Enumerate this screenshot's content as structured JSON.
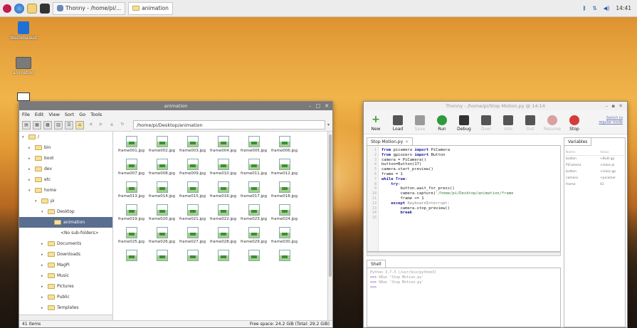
{
  "taskbar": {
    "tasks": [
      {
        "label": "Thonny - /home/pi/..."
      },
      {
        "label": "animation"
      }
    ],
    "clock": "14:41"
  },
  "desktop": {
    "icons": [
      {
        "label": "Wastebasket"
      },
      {
        "label": "animation"
      }
    ]
  },
  "file_manager": {
    "title": "animation",
    "menu": [
      "File",
      "Edit",
      "View",
      "Sort",
      "Go",
      "Tools"
    ],
    "path": "/home/pi/Desktop/animation",
    "tree": [
      {
        "label": "/",
        "depth": 0,
        "arrow": "▾"
      },
      {
        "label": "bin",
        "depth": 1,
        "arrow": "▸"
      },
      {
        "label": "boot",
        "depth": 1,
        "arrow": "▸"
      },
      {
        "label": "dev",
        "depth": 1,
        "arrow": "▸"
      },
      {
        "label": "etc",
        "depth": 1,
        "arrow": "▸"
      },
      {
        "label": "home",
        "depth": 1,
        "arrow": "▾"
      },
      {
        "label": "pi",
        "depth": 2,
        "arrow": "▾"
      },
      {
        "label": "Desktop",
        "depth": 3,
        "arrow": "▾"
      },
      {
        "label": "animation",
        "depth": 4,
        "arrow": "▾",
        "selected": true
      },
      {
        "label": "<No sub-folders>",
        "depth": 5,
        "arrow": ""
      },
      {
        "label": "Documents",
        "depth": 3,
        "arrow": "▸"
      },
      {
        "label": "Downloads",
        "depth": 3,
        "arrow": "▸"
      },
      {
        "label": "MagPi",
        "depth": 3,
        "arrow": "▸"
      },
      {
        "label": "Music",
        "depth": 3,
        "arrow": "▸"
      },
      {
        "label": "Pictures",
        "depth": 3,
        "arrow": "▸"
      },
      {
        "label": "Public",
        "depth": 3,
        "arrow": "▸"
      },
      {
        "label": "Templates",
        "depth": 3,
        "arrow": "▸"
      }
    ],
    "files": [
      "frame001.jpg",
      "frame002.jpg",
      "frame003.jpg",
      "frame004.jpg",
      "frame005.jpg",
      "frame006.jpg",
      "frame007.jpg",
      "frame008.jpg",
      "frame009.jpg",
      "frame010.jpg",
      "frame011.jpg",
      "frame012.jpg",
      "frame013.jpg",
      "frame014.jpg",
      "frame015.jpg",
      "frame016.jpg",
      "frame017.jpg",
      "frame018.jpg",
      "frame019.jpg",
      "frame020.jpg",
      "frame021.jpg",
      "frame022.jpg",
      "frame023.jpg",
      "frame024.jpg",
      "frame025.jpg",
      "frame026.jpg",
      "frame027.jpg",
      "frame028.jpg",
      "frame029.jpg",
      "frame030.jpg",
      "",
      "",
      "",
      "",
      "",
      ""
    ],
    "status_left": "41 items",
    "status_right": "Free space: 24.2 GiB (Total: 29.2 GiB)"
  },
  "thonny": {
    "title": "Thonny - /home/pi/Stop Motion.py @ 14:14",
    "switch_mode": [
      "Switch to",
      "regular mode"
    ],
    "toolbar": [
      {
        "label": "New",
        "icon": "new-icon",
        "color": "#3a9a3a",
        "enabled": true
      },
      {
        "label": "Load",
        "icon": "load-icon",
        "color": "#555555",
        "enabled": true
      },
      {
        "label": "Save",
        "icon": "save-icon",
        "color": "#9a9a9a",
        "enabled": false
      },
      {
        "label": "Run",
        "icon": "run-icon",
        "color": "#2e9a3a",
        "enabled": true
      },
      {
        "label": "Debug",
        "icon": "debug-icon",
        "color": "#333333",
        "enabled": true
      },
      {
        "label": "Over",
        "icon": "step-over-icon",
        "color": "#555555",
        "enabled": false
      },
      {
        "label": "Into",
        "icon": "step-into-icon",
        "color": "#555555",
        "enabled": false
      },
      {
        "label": "Out",
        "icon": "step-out-icon",
        "color": "#555555",
        "enabled": false
      },
      {
        "label": "Resume",
        "icon": "resume-icon",
        "color": "#d8a0a0",
        "enabled": false
      },
      {
        "label": "Stop",
        "icon": "stop-icon",
        "color": "#d83a3a",
        "enabled": true
      }
    ],
    "editor_tab": "Stop Motion.py",
    "line_numbers": [
      "1",
      "2",
      "3",
      "4",
      "5",
      "6",
      "7",
      "8",
      "9",
      "10",
      "11",
      "12",
      "13",
      "14",
      "15"
    ],
    "code_lines": [
      [
        {
          "t": "from ",
          "c": "kw"
        },
        {
          "t": "picamera ",
          "c": ""
        },
        {
          "t": "import ",
          "c": "kw"
        },
        {
          "t": "PiCamera",
          "c": ""
        }
      ],
      [
        {
          "t": "from ",
          "c": "kw"
        },
        {
          "t": "gpiozero ",
          "c": ""
        },
        {
          "t": "import ",
          "c": "kw"
        },
        {
          "t": "Button",
          "c": ""
        }
      ],
      [
        {
          "t": "camera = PiCamera()",
          "c": ""
        }
      ],
      [
        {
          "t": "button=Button(17)",
          "c": ""
        }
      ],
      [
        {
          "t": "camera.start_preview()",
          "c": ""
        }
      ],
      [
        {
          "t": "frame = 1",
          "c": ""
        }
      ],
      [
        {
          "t": "while True",
          "c": "kw"
        },
        {
          "t": ":",
          "c": ""
        }
      ],
      [
        {
          "t": "    try",
          "c": "kw"
        },
        {
          "t": ":",
          "c": ""
        }
      ],
      [
        {
          "t": "        button.wait_for_press()",
          "c": ""
        }
      ],
      [
        {
          "t": "        camera.capture(",
          "c": ""
        },
        {
          "t": "'/home/pi/Desktop/animation/frame",
          "c": "str"
        }
      ],
      [
        {
          "t": "        frame += 1",
          "c": ""
        }
      ],
      [
        {
          "t": "    except ",
          "c": "kw"
        },
        {
          "t": "KeyboardInterrupt:",
          "c": "cm"
        }
      ],
      [
        {
          "t": "        camera.stop_preview()",
          "c": ""
        }
      ],
      [
        {
          "t": "        break",
          "c": "kw"
        }
      ],
      [
        {
          "t": "",
          "c": ""
        }
      ]
    ],
    "shell_tab": "Shell",
    "shell_lines": [
      {
        "prompt": "",
        "text": "Python 3.7.3 (/usr/bin/python3)"
      },
      {
        "prompt": ">>>",
        "text": "%Run 'Stop Motion.py'"
      },
      {
        "prompt": ">>>",
        "text": "%Run 'Stop Motion.py'"
      },
      {
        "prompt": ">>>",
        "text": ""
      }
    ],
    "variables_tab": "Variables",
    "variables_header": {
      "name": "Name",
      "value": "Value"
    },
    "variables": [
      {
        "name": "button",
        "value": "<Butt gp"
      },
      {
        "name": "PiCamera",
        "value": "<class pi"
      },
      {
        "name": "button",
        "value": "<class gp"
      },
      {
        "name": "camera",
        "value": "<picamer"
      },
      {
        "name": "frame",
        "value": "41"
      }
    ]
  },
  "colors": {
    "selection": "#5a6e8f",
    "keyword": "#1a1a9a",
    "run_green": "#2e9a3a",
    "stop_red": "#d83a3a"
  }
}
